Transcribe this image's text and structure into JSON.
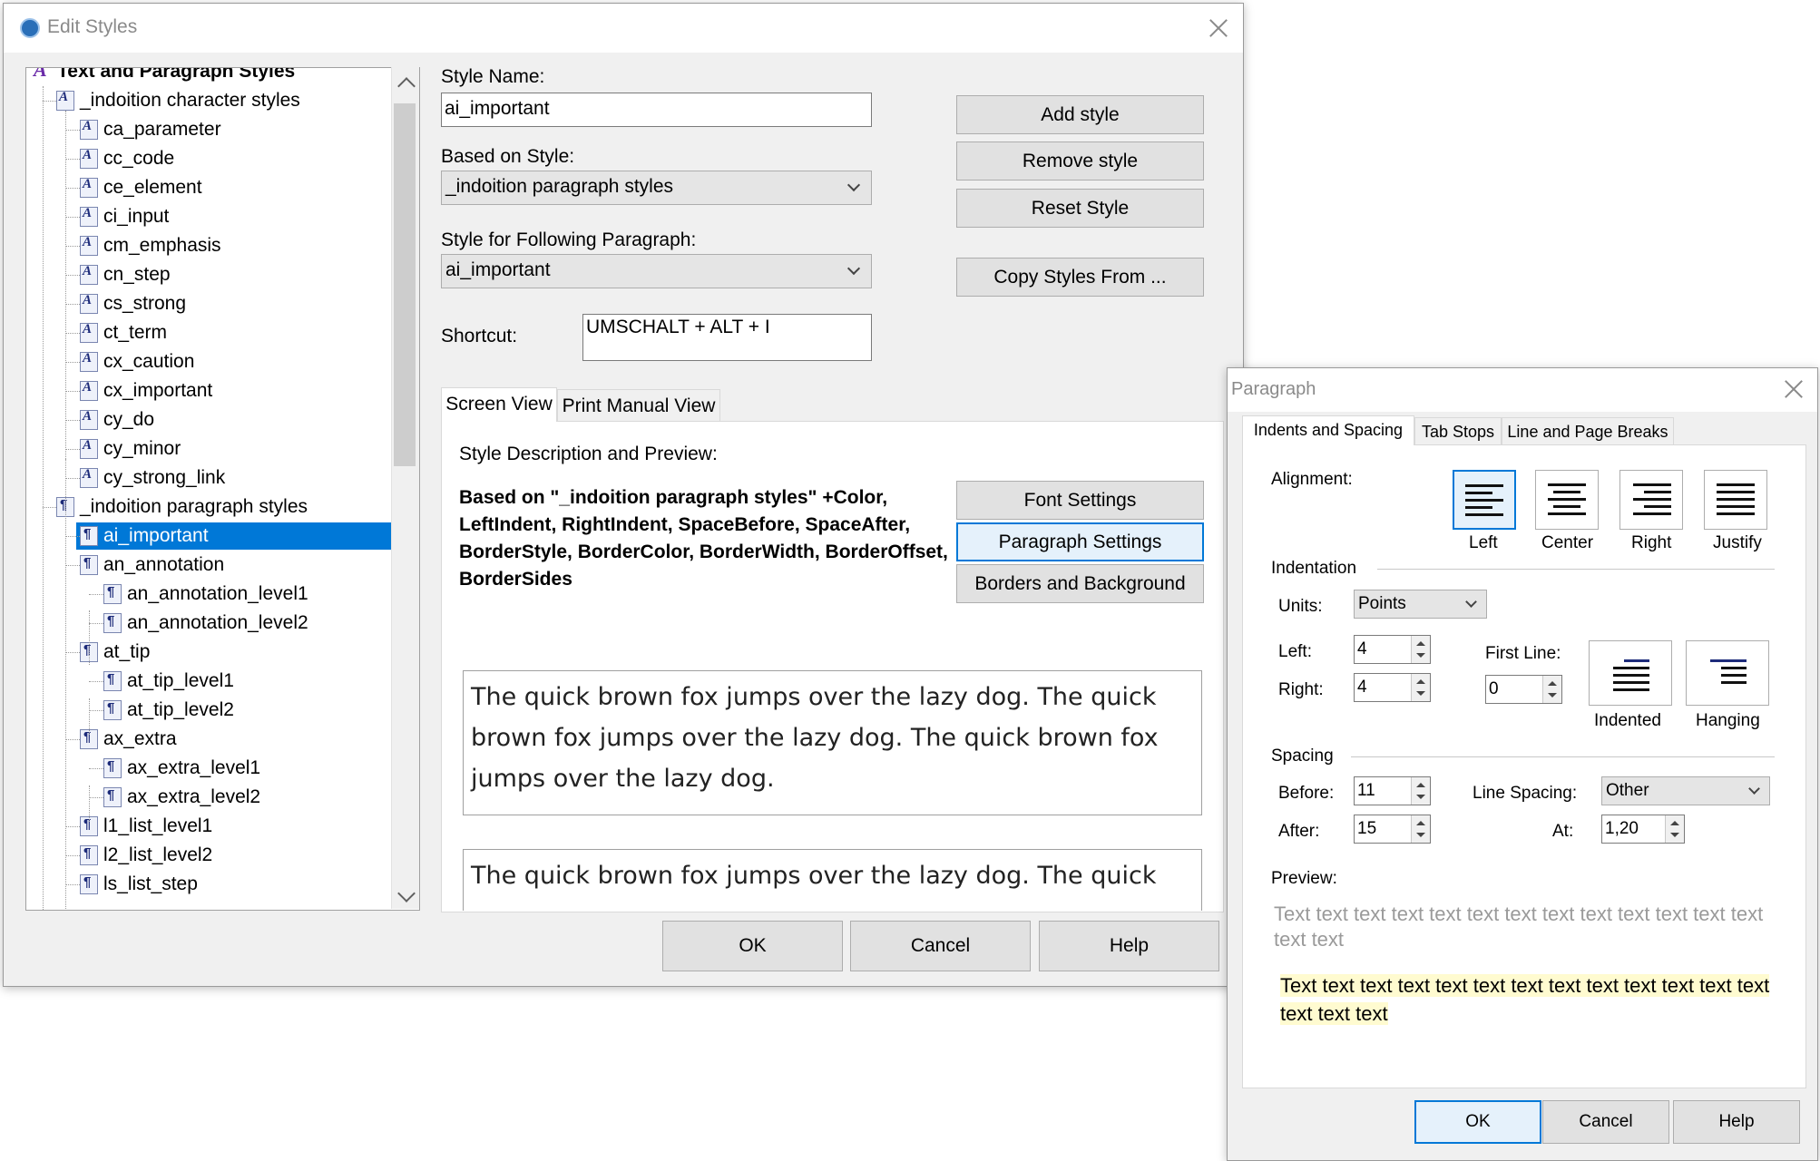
{
  "edit_styles": {
    "title": "Edit Styles",
    "tree": [
      {
        "label": "Text and Paragraph Styles",
        "level": 0,
        "icon": "root",
        "bold": true
      },
      {
        "label": "_indoition character styles",
        "level": 1,
        "icon": "char"
      },
      {
        "label": "ca_parameter",
        "level": 2,
        "icon": "char"
      },
      {
        "label": "cc_code",
        "level": 2,
        "icon": "char"
      },
      {
        "label": "ce_element",
        "level": 2,
        "icon": "char"
      },
      {
        "label": "ci_input",
        "level": 2,
        "icon": "char"
      },
      {
        "label": "cm_emphasis",
        "level": 2,
        "icon": "char"
      },
      {
        "label": "cn_step",
        "level": 2,
        "icon": "char"
      },
      {
        "label": "cs_strong",
        "level": 2,
        "icon": "char"
      },
      {
        "label": "ct_term",
        "level": 2,
        "icon": "char"
      },
      {
        "label": "cx_caution",
        "level": 2,
        "icon": "char"
      },
      {
        "label": "cx_important",
        "level": 2,
        "icon": "char"
      },
      {
        "label": "cy_do",
        "level": 2,
        "icon": "char"
      },
      {
        "label": "cy_minor",
        "level": 2,
        "icon": "char"
      },
      {
        "label": "cy_strong_link",
        "level": 2,
        "icon": "char"
      },
      {
        "label": "_indoition paragraph styles",
        "level": 1,
        "icon": "para"
      },
      {
        "label": "ai_important",
        "level": 2,
        "icon": "para",
        "selected": true
      },
      {
        "label": "an_annotation",
        "level": 2,
        "icon": "para"
      },
      {
        "label": "an_annotation_level1",
        "level": 3,
        "icon": "para"
      },
      {
        "label": "an_annotation_level2",
        "level": 3,
        "icon": "para"
      },
      {
        "label": "at_tip",
        "level": 2,
        "icon": "para"
      },
      {
        "label": "at_tip_level1",
        "level": 3,
        "icon": "para"
      },
      {
        "label": "at_tip_level2",
        "level": 3,
        "icon": "para"
      },
      {
        "label": "ax_extra",
        "level": 2,
        "icon": "para"
      },
      {
        "label": "ax_extra_level1",
        "level": 3,
        "icon": "para"
      },
      {
        "label": "ax_extra_level2",
        "level": 3,
        "icon": "para"
      },
      {
        "label": "l1_list_level1",
        "level": 2,
        "icon": "para"
      },
      {
        "label": "l2_list_level2",
        "level": 2,
        "icon": "para"
      },
      {
        "label": "ls_list_step",
        "level": 2,
        "icon": "para"
      }
    ],
    "style_name_label": "Style Name:",
    "style_name_value": "ai_important",
    "based_on_label": "Based on Style:",
    "based_on_value": "_indoition paragraph styles",
    "following_label": "Style for Following Paragraph:",
    "following_value": "ai_important",
    "shortcut_label": "Shortcut:",
    "shortcut_value": "UMSCHALT + ALT + I",
    "add_style": "Add style",
    "remove_style": "Remove style",
    "reset_style": "Reset Style",
    "copy_styles": "Copy Styles From ...",
    "tabs": [
      "Screen View",
      "Print Manual View"
    ],
    "desc_label": "Style Description and Preview:",
    "description": "Based on \"_indoition paragraph styles\" +Color, LeftIndent, RightIndent, SpaceBefore, SpaceAfter, BorderStyle, BorderColor, BorderWidth, BorderOffset, BorderSides",
    "font_settings": "Font Settings",
    "paragraph_settings": "Paragraph Settings",
    "borders_background": "Borders and Background",
    "preview_text_1": "The quick brown fox jumps over the lazy dog. The quick brown fox jumps over the lazy dog. The quick brown fox jumps over the lazy dog.",
    "preview_text_2": "The quick brown fox jumps over the lazy dog. The quick",
    "ok": "OK",
    "cancel": "Cancel",
    "help": "Help"
  },
  "paragraph": {
    "title": "Paragraph",
    "tabs": [
      "Indents and Spacing",
      "Tab Stops",
      "Line and Page Breaks"
    ],
    "alignment_label": "Alignment:",
    "align_left": "Left",
    "align_center": "Center",
    "align_right": "Right",
    "align_justify": "Justify",
    "indentation_label": "Indentation",
    "units_label": "Units:",
    "units_value": "Points",
    "left_label": "Left:",
    "left_value": "4",
    "right_label": "Right:",
    "right_value": "4",
    "first_line_label": "First Line:",
    "first_line_value": "0",
    "indented": "Indented",
    "hanging": "Hanging",
    "spacing_label": "Spacing",
    "before_label": "Before:",
    "before_value": "11",
    "after_label": "After:",
    "after_value": "15",
    "line_spacing_label": "Line Spacing:",
    "line_spacing_value": "Other",
    "at_label": "At:",
    "at_value": "1,20",
    "preview_label": "Preview:",
    "preview_gray": "Text text text text text text text text text text text text text text text",
    "preview_sample": "Text text text text text text text text text text text text text text text text",
    "ok": "OK",
    "cancel": "Cancel",
    "help": "Help"
  },
  "colors": {
    "selection": "#0078d7",
    "preview_highlight": "#fffbd0"
  }
}
